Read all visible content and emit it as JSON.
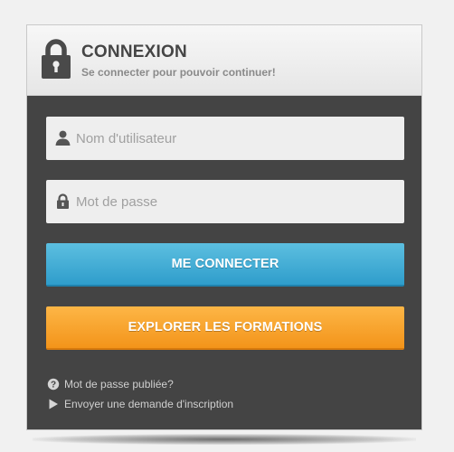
{
  "header": {
    "title": "CONNEXION",
    "subtitle": "Se connecter pour pouvoir continuer!",
    "icon": "lock-icon"
  },
  "form": {
    "username": {
      "placeholder": "Nom d'utilisateur",
      "value": "",
      "icon": "user-icon"
    },
    "password": {
      "placeholder": "Mot de passe",
      "value": "",
      "icon": "lock-icon"
    },
    "login_label": "ME CONNECTER",
    "explore_label": "EXPLORER LES FORMATIONS"
  },
  "links": {
    "forgot_password": "Mot de passe publiée?",
    "request_signup": "Envoyer une demande d'inscription"
  },
  "colors": {
    "panel": "#444444",
    "login_button": "#3aa8d4",
    "explore_button": "#f7a124",
    "header_bg": "#eeeeee"
  }
}
